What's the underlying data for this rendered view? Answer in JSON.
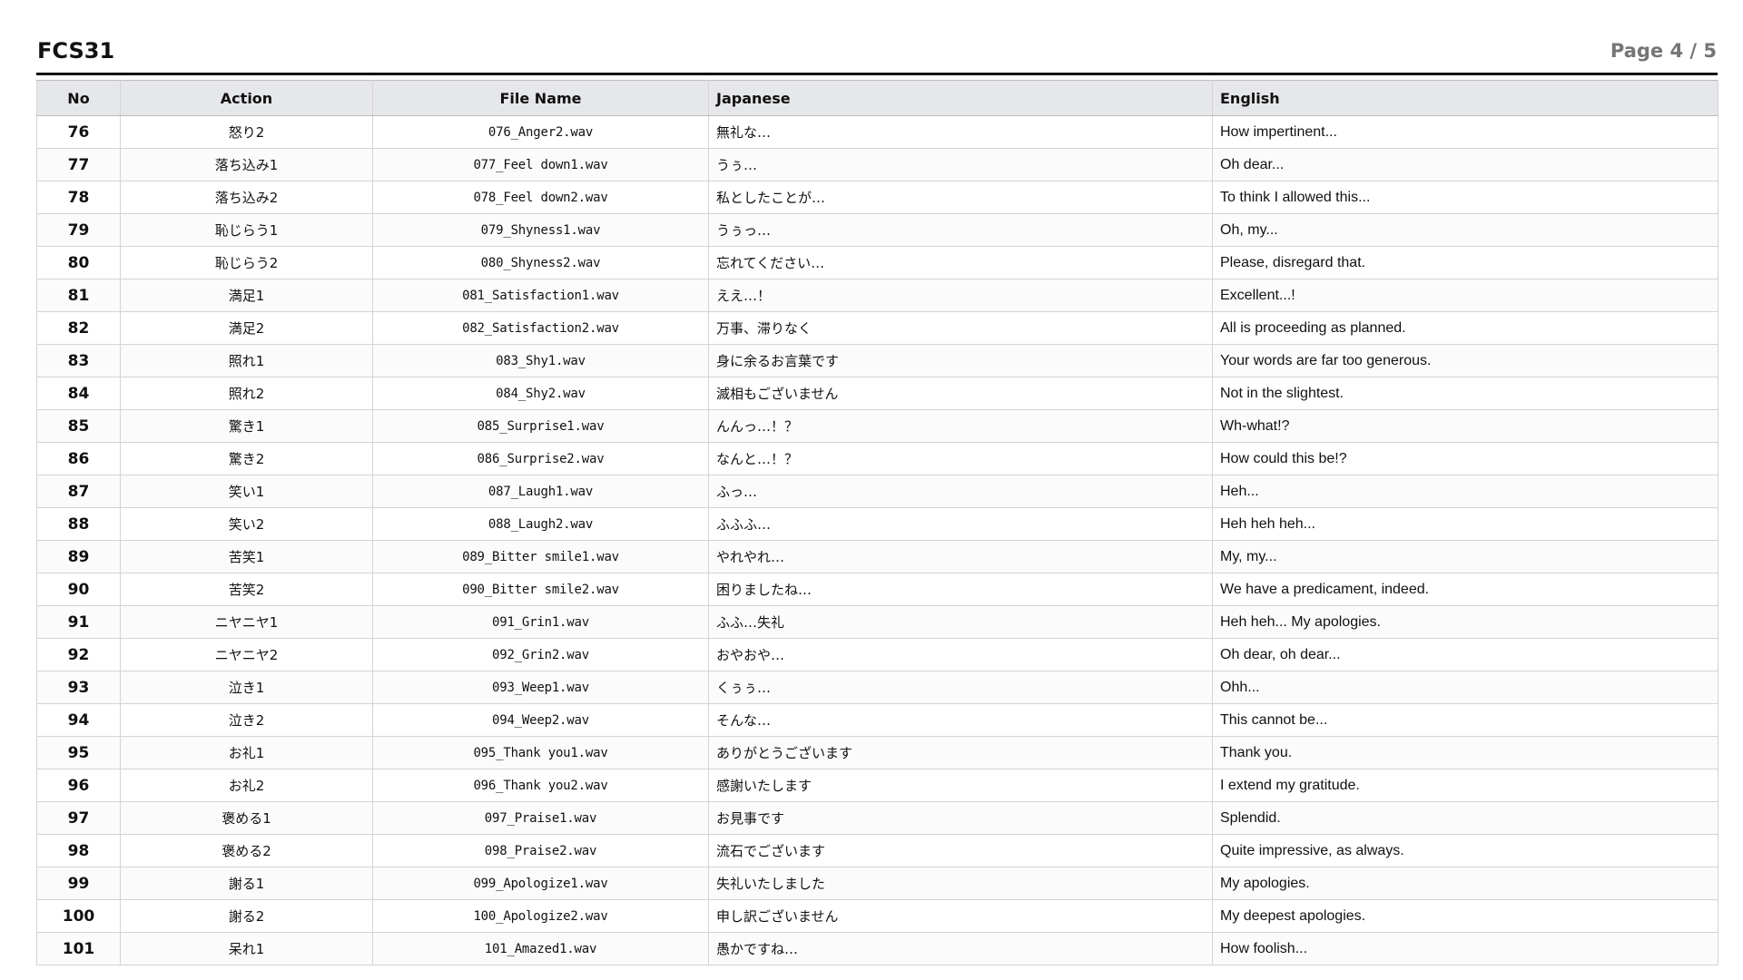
{
  "header": {
    "title": "FCS31",
    "page_indicator": "Page 4 / 5"
  },
  "table": {
    "columns": [
      "No",
      "Action",
      "File Name",
      "Japanese",
      "English"
    ],
    "rows": [
      [
        "76",
        "怒り2",
        "076_Anger2.wav",
        "無礼な…",
        "How impertinent..."
      ],
      [
        "77",
        "落ち込み1",
        "077_Feel down1.wav",
        "うぅ…",
        "Oh dear..."
      ],
      [
        "78",
        "落ち込み2",
        "078_Feel down2.wav",
        "私としたことが…",
        "To think I allowed this..."
      ],
      [
        "79",
        "恥じらう1",
        "079_Shyness1.wav",
        "うぅっ…",
        "Oh, my..."
      ],
      [
        "80",
        "恥じらう2",
        "080_Shyness2.wav",
        "忘れてください…",
        "Please, disregard that."
      ],
      [
        "81",
        "満足1",
        "081_Satisfaction1.wav",
        "ええ…！",
        "Excellent...!"
      ],
      [
        "82",
        "満足2",
        "082_Satisfaction2.wav",
        "万事、滞りなく",
        "All is proceeding as planned."
      ],
      [
        "83",
        "照れ1",
        "083_Shy1.wav",
        "身に余るお言葉です",
        "Your words are far too generous."
      ],
      [
        "84",
        "照れ2",
        "084_Shy2.wav",
        "滅相もございません",
        "Not in the slightest."
      ],
      [
        "85",
        "驚き1",
        "085_Surprise1.wav",
        "んんっ…！？",
        "Wh-what!?"
      ],
      [
        "86",
        "驚き2",
        "086_Surprise2.wav",
        "なんと…！？",
        "How could this be!?"
      ],
      [
        "87",
        "笑い1",
        "087_Laugh1.wav",
        "ふっ…",
        "Heh..."
      ],
      [
        "88",
        "笑い2",
        "088_Laugh2.wav",
        "ふふふ…",
        "Heh heh heh..."
      ],
      [
        "89",
        "苦笑1",
        "089_Bitter smile1.wav",
        "やれやれ…",
        "My, my..."
      ],
      [
        "90",
        "苦笑2",
        "090_Bitter smile2.wav",
        "困りましたね…",
        "We have a predicament, indeed."
      ],
      [
        "91",
        "ニヤニヤ1",
        "091_Grin1.wav",
        "ふふ…失礼",
        "Heh heh... My apologies."
      ],
      [
        "92",
        "ニヤニヤ2",
        "092_Grin2.wav",
        "おやおや…",
        "Oh dear, oh dear..."
      ],
      [
        "93",
        "泣き1",
        "093_Weep1.wav",
        "くぅぅ…",
        "Ohh..."
      ],
      [
        "94",
        "泣き2",
        "094_Weep2.wav",
        "そんな…",
        "This cannot be..."
      ],
      [
        "95",
        "お礼1",
        "095_Thank you1.wav",
        "ありがとうございます",
        "Thank you."
      ],
      [
        "96",
        "お礼2",
        "096_Thank you2.wav",
        "感謝いたします",
        "I extend my gratitude."
      ],
      [
        "97",
        "褒める1",
        "097_Praise1.wav",
        "お見事です",
        "Splendid."
      ],
      [
        "98",
        "褒める2",
        "098_Praise2.wav",
        "流石でございます",
        "Quite impressive, as always."
      ],
      [
        "99",
        "謝る1",
        "099_Apologize1.wav",
        "失礼いたしました",
        "My apologies."
      ],
      [
        "100",
        "謝る2",
        "100_Apologize2.wav",
        "申し訳ございません",
        "My deepest apologies."
      ],
      [
        "101",
        "呆れ1",
        "101_Amazed1.wav",
        "愚かですね…",
        "How foolish..."
      ]
    ]
  }
}
